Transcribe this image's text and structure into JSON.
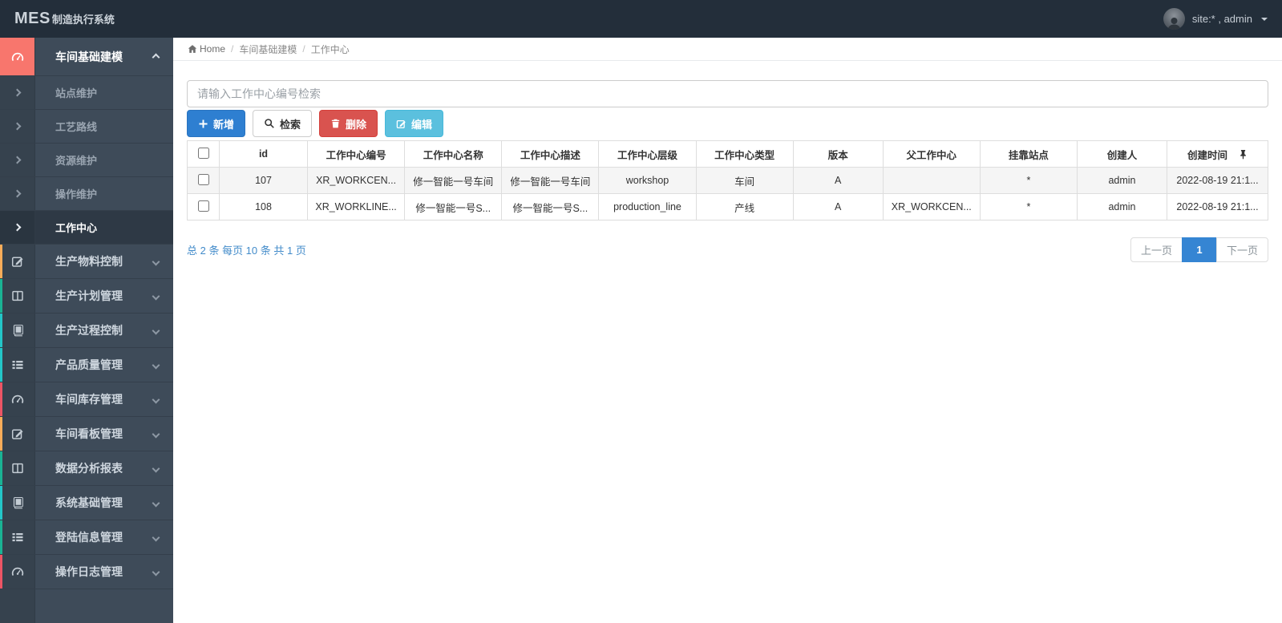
{
  "navbar": {
    "brand_mes": "MES",
    "brand_suffix": "制造执行系统",
    "user": "site:* , admin"
  },
  "breadcrumb": {
    "home": "Home",
    "separator": "/",
    "items": [
      "车间基础建模",
      "工作中心"
    ]
  },
  "sidebar": {
    "expanded": {
      "label": "车间基础建模",
      "icon": "gauge-icon",
      "accent": "#f8766d"
    },
    "submenu": [
      {
        "label": "站点维护",
        "active": false
      },
      {
        "label": "工艺路线",
        "active": false
      },
      {
        "label": "资源维护",
        "active": false
      },
      {
        "label": "操作维护",
        "active": false
      },
      {
        "label": "工作中心",
        "active": true
      }
    ],
    "items": [
      {
        "label": "生产物料控制",
        "icon": "edit-square-icon",
        "accent": "#f8ac59"
      },
      {
        "label": "生产计划管理",
        "icon": "columns-icon",
        "accent": "#1ab394"
      },
      {
        "label": "生产过程控制",
        "icon": "book-icon",
        "accent": "#23c6c8"
      },
      {
        "label": "产品质量管理",
        "icon": "list-icon",
        "accent": "#23c6c8"
      },
      {
        "label": "车间库存管理",
        "icon": "gauge-icon",
        "accent": "#ed5565"
      },
      {
        "label": "车间看板管理",
        "icon": "edit-square-icon",
        "accent": "#f8ac59"
      },
      {
        "label": "数据分析报表",
        "icon": "columns-icon",
        "accent": "#1ab394"
      },
      {
        "label": "系统基础管理",
        "icon": "book-icon",
        "accent": "#23c6c8"
      },
      {
        "label": "登陆信息管理",
        "icon": "list-icon",
        "accent": "#1ab394"
      },
      {
        "label": "操作日志管理",
        "icon": "gauge-icon",
        "accent": "#ed5565"
      }
    ]
  },
  "search": {
    "placeholder": "请输入工作中心编号检索",
    "value": ""
  },
  "toolbar": {
    "add_label": "新增",
    "search_label": "检索",
    "delete_label": "删除",
    "edit_label": "编辑"
  },
  "table": {
    "columns": [
      "id",
      "工作中心编号",
      "工作中心名称",
      "工作中心描述",
      "工作中心层级",
      "工作中心类型",
      "版本",
      "父工作中心",
      "挂靠站点",
      "创建人",
      "创建时间"
    ],
    "rows": [
      [
        "107",
        "XR_WORKCEN...",
        "修一智能一号车间",
        "修一智能一号车间",
        "workshop",
        "车间",
        "A",
        "",
        "*",
        "admin",
        "2022-08-19 21:1..."
      ],
      [
        "108",
        "XR_WORKLINE...",
        "修一智能一号S...",
        "修一智能一号S...",
        "production_line",
        "产线",
        "A",
        "XR_WORKCEN...",
        "*",
        "admin",
        "2022-08-19 21:1..."
      ]
    ]
  },
  "pagination": {
    "summary": "总 2 条 每页 10 条 共 1 页",
    "prev": "上一页",
    "page": "1",
    "next": "下一页"
  },
  "colors": {
    "navbar_bg": "#232e3a",
    "sidebar_bg": "#3e4b59",
    "sidebar_icon_col_bg": "#36424e",
    "active_parent_accent": "#f8766d",
    "primary_button": "#2e7fd1",
    "danger_button": "#d9534f",
    "info_button": "#5bc0de",
    "active_page": "#3585d3",
    "link_blue": "#428bca"
  }
}
